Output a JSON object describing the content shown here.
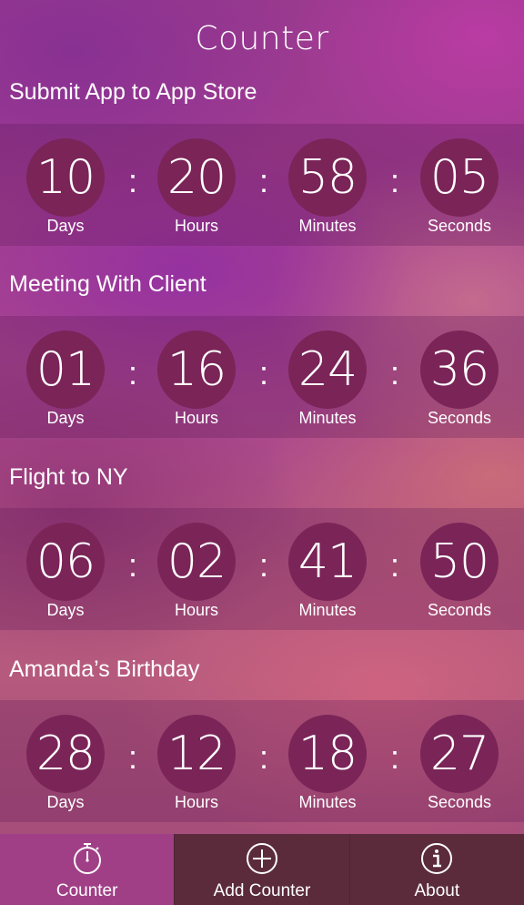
{
  "header": {
    "title": "Counter"
  },
  "counters": [
    {
      "name": "Submit App to App Store",
      "days": "10",
      "hours": "20",
      "minutes": "58",
      "seconds": "05"
    },
    {
      "name": "Meeting With Client",
      "days": "01",
      "hours": "16",
      "minutes": "24",
      "seconds": "36"
    },
    {
      "name": "Flight to NY",
      "days": "06",
      "hours": "02",
      "minutes": "41",
      "seconds": "50"
    },
    {
      "name": "Amanda’s Birthday",
      "days": "28",
      "hours": "12",
      "minutes": "18",
      "seconds": "27"
    }
  ],
  "units": {
    "days": "Days",
    "hours": "Hours",
    "minutes": "Minutes",
    "seconds": "Seconds",
    "separator": ":"
  },
  "tabs": [
    {
      "label": "Counter",
      "icon": "stopwatch-icon",
      "active": true
    },
    {
      "label": "Add Counter",
      "icon": "plus-circle-icon",
      "active": false
    },
    {
      "label": "About",
      "icon": "info-icon",
      "active": false
    }
  ],
  "colors": {
    "circle": "#7a2458",
    "active_tab": "#a03f86",
    "inactive_tab": "#5b2b3c"
  }
}
